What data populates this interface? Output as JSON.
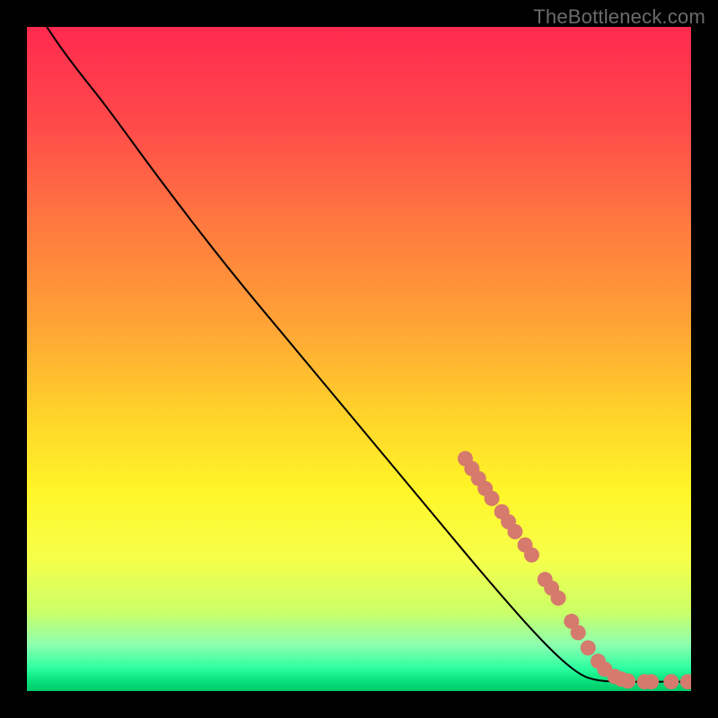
{
  "watermark": "TheBottleneck.com",
  "gradient": {
    "stops": [
      {
        "offset": 0.0,
        "color": "#ff2a4f"
      },
      {
        "offset": 0.15,
        "color": "#ff4b4a"
      },
      {
        "offset": 0.3,
        "color": "#ff7a3f"
      },
      {
        "offset": 0.45,
        "color": "#ffa436"
      },
      {
        "offset": 0.58,
        "color": "#ffd22a"
      },
      {
        "offset": 0.7,
        "color": "#fff628"
      },
      {
        "offset": 0.8,
        "color": "#f6ff4a"
      },
      {
        "offset": 0.88,
        "color": "#ccff66"
      },
      {
        "offset": 0.93,
        "color": "#8dffb0"
      },
      {
        "offset": 0.965,
        "color": "#2effa0"
      },
      {
        "offset": 0.985,
        "color": "#07e07a"
      },
      {
        "offset": 1.0,
        "color": "#00c96a"
      }
    ]
  },
  "curve_color": "#000000",
  "marker_color": "#d57a6d",
  "chart_data": {
    "type": "line",
    "title": "",
    "xlabel": "",
    "ylabel": "",
    "xlim": [
      0,
      100
    ],
    "ylim": [
      0,
      100
    ],
    "series": [
      {
        "name": "curve",
        "points": [
          {
            "x": 3,
            "y": 100
          },
          {
            "x": 5,
            "y": 97
          },
          {
            "x": 8,
            "y": 93
          },
          {
            "x": 12,
            "y": 88
          },
          {
            "x": 20,
            "y": 77
          },
          {
            "x": 30,
            "y": 64
          },
          {
            "x": 40,
            "y": 52
          },
          {
            "x": 50,
            "y": 40
          },
          {
            "x": 60,
            "y": 28
          },
          {
            "x": 70,
            "y": 16
          },
          {
            "x": 78,
            "y": 7
          },
          {
            "x": 83,
            "y": 2.5
          },
          {
            "x": 86,
            "y": 1.5
          },
          {
            "x": 90,
            "y": 1.4
          },
          {
            "x": 95,
            "y": 1.4
          },
          {
            "x": 100,
            "y": 1.4
          }
        ]
      },
      {
        "name": "markers",
        "points": [
          {
            "x": 66,
            "y": 35
          },
          {
            "x": 67,
            "y": 33.5
          },
          {
            "x": 68,
            "y": 32
          },
          {
            "x": 69,
            "y": 30.5
          },
          {
            "x": 70,
            "y": 29
          },
          {
            "x": 71.5,
            "y": 27
          },
          {
            "x": 72.5,
            "y": 25.5
          },
          {
            "x": 73.5,
            "y": 24
          },
          {
            "x": 75,
            "y": 22
          },
          {
            "x": 76,
            "y": 20.5
          },
          {
            "x": 78,
            "y": 16.8
          },
          {
            "x": 79,
            "y": 15.5
          },
          {
            "x": 80,
            "y": 14
          },
          {
            "x": 82,
            "y": 10.5
          },
          {
            "x": 83,
            "y": 8.8
          },
          {
            "x": 84.5,
            "y": 6.5
          },
          {
            "x": 86,
            "y": 4.5
          },
          {
            "x": 87,
            "y": 3.3
          },
          {
            "x": 88.5,
            "y": 2.2
          },
          {
            "x": 89.5,
            "y": 1.8
          },
          {
            "x": 90.5,
            "y": 1.5
          },
          {
            "x": 93,
            "y": 1.4
          },
          {
            "x": 94,
            "y": 1.4
          },
          {
            "x": 97,
            "y": 1.4
          },
          {
            "x": 99.5,
            "y": 1.4
          }
        ]
      }
    ]
  }
}
